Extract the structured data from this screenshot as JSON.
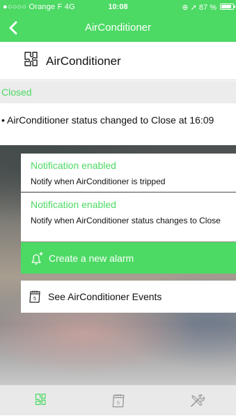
{
  "status_bar": {
    "carrier": "●○○○○ Orange F  4G",
    "time": "10:08",
    "indicators": "⊕ ➚ 87 %",
    "battery_level": 0.87
  },
  "nav": {
    "title": "AirConditioner",
    "back_icon": "chevron-left-icon"
  },
  "device": {
    "name": "AirConditioner",
    "icon": "puzzle-icon"
  },
  "state": "Closed",
  "history": "• AirConditioner status changed to Close at 16:09",
  "notifications": [
    {
      "title": "Notification enabled",
      "description": "Notify when AirConditioner is tripped"
    },
    {
      "title": "Notification enabled",
      "description": "Notify when AirConditioner status changes to Close"
    }
  ],
  "alarm_button": {
    "label": "Create a new alarm",
    "icon": "bell-add-icon"
  },
  "events_button": {
    "label": "See AirConditioner Events",
    "icon": "calendar-icon"
  },
  "tabs": [
    {
      "icon": "puzzle-icon",
      "active": true
    },
    {
      "icon": "calendar-icon",
      "active": false
    },
    {
      "icon": "tools-icon",
      "active": false
    }
  ],
  "colors": {
    "accent": "#4cd964",
    "state_background": "#ececec",
    "tab_inactive": "#9a9a9a"
  }
}
